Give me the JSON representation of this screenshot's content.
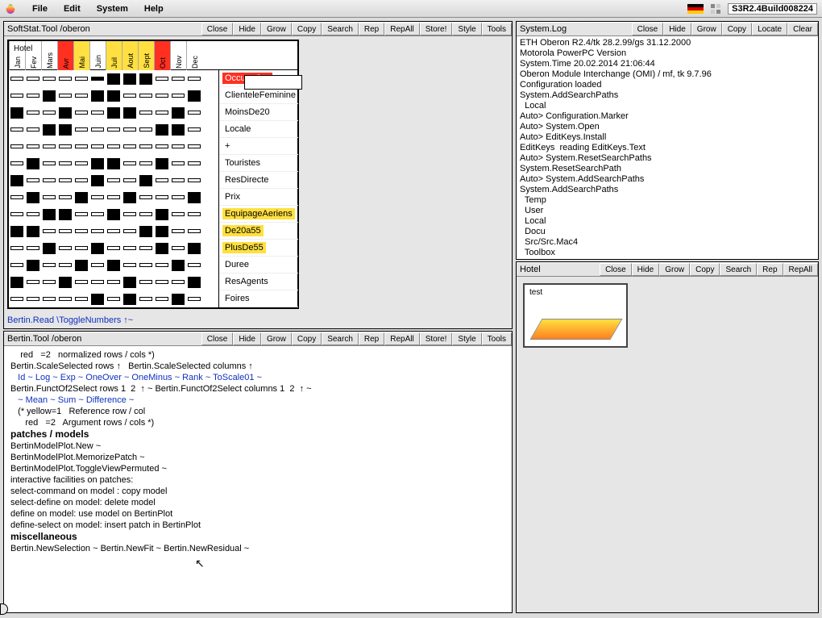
{
  "menubar": {
    "items": [
      "File",
      "Edit",
      "System",
      "Help"
    ],
    "build": "S3R2.4Build008224"
  },
  "soft_viewer": {
    "title": "SoftStat.Tool /oberon",
    "buttons": [
      "Close",
      "Hide",
      "Grow",
      "Copy",
      "Search",
      "Rep",
      "RepAll",
      "Store!"
    ],
    "right_buttons": [
      "Style",
      "Tools"
    ],
    "caption": "Hotel",
    "months": [
      {
        "label": "Jan",
        "color": ""
      },
      {
        "label": "Fev",
        "color": ""
      },
      {
        "label": "Mars",
        "color": ""
      },
      {
        "label": "Avr",
        "color": "red"
      },
      {
        "label": "Mai",
        "color": "yellow"
      },
      {
        "label": "Juin",
        "color": ""
      },
      {
        "label": "Juil",
        "color": "yellow"
      },
      {
        "label": "Aout",
        "color": "yellow"
      },
      {
        "label": "Sept",
        "color": "yellow"
      },
      {
        "label": "Oct",
        "color": "red"
      },
      {
        "label": "Nov",
        "color": ""
      },
      {
        "label": "Dec",
        "color": ""
      }
    ],
    "rows": [
      {
        "label": "Occupation",
        "color": "red",
        "pattern": [
          4,
          3,
          4,
          3,
          4,
          5,
          14,
          14,
          14,
          3,
          4,
          3
        ]
      },
      {
        "label": "ClienteleFeminine",
        "color": "",
        "pattern": [
          4,
          3,
          14,
          3,
          4,
          14,
          14,
          3,
          4,
          3,
          4,
          14
        ]
      },
      {
        "label": "MoinsDe20",
        "color": "",
        "pattern": [
          14,
          3,
          4,
          14,
          4,
          3,
          14,
          14,
          4,
          3,
          14,
          3
        ]
      },
      {
        "label": "Locale",
        "color": "",
        "pattern": [
          3,
          3,
          14,
          14,
          4,
          3,
          4,
          3,
          4,
          14,
          14,
          3
        ]
      },
      {
        "label": "+",
        "color": "",
        "pattern": [
          2,
          2,
          2,
          2,
          2,
          2,
          2,
          2,
          2,
          2,
          2,
          2
        ]
      },
      {
        "label": "Touristes",
        "color": "",
        "pattern": [
          4,
          14,
          3,
          4,
          3,
          14,
          14,
          3,
          4,
          14,
          4,
          3
        ]
      },
      {
        "label": "ResDirecte",
        "color": "",
        "pattern": [
          14,
          3,
          4,
          3,
          4,
          14,
          4,
          3,
          14,
          3,
          4,
          3
        ]
      },
      {
        "label": "Prix",
        "color": "",
        "pattern": [
          3,
          14,
          4,
          3,
          14,
          4,
          3,
          14,
          3,
          4,
          3,
          14
        ]
      },
      {
        "label": "EquipageAeriens",
        "color": "yellow",
        "pattern": [
          3,
          4,
          14,
          14,
          3,
          4,
          14,
          3,
          4,
          14,
          3,
          4
        ]
      },
      {
        "label": "De20a55",
        "color": "yellow",
        "pattern": [
          14,
          14,
          4,
          3,
          4,
          3,
          4,
          3,
          14,
          14,
          4,
          3
        ]
      },
      {
        "label": "PlusDe55",
        "color": "yellow",
        "pattern": [
          4,
          3,
          14,
          3,
          4,
          14,
          3,
          4,
          3,
          14,
          4,
          14
        ]
      },
      {
        "label": "Duree",
        "color": "",
        "pattern": [
          3,
          14,
          4,
          3,
          14,
          4,
          14,
          3,
          4,
          3,
          14,
          3
        ]
      },
      {
        "label": "ResAgents",
        "color": "",
        "pattern": [
          14,
          3,
          4,
          14,
          3,
          4,
          3,
          14,
          4,
          3,
          4,
          14
        ]
      },
      {
        "label": "Foires",
        "color": "",
        "pattern": [
          3,
          4,
          3,
          4,
          3,
          14,
          4,
          14,
          3,
          4,
          14,
          3
        ]
      }
    ],
    "cmd_line": "Bertin.Read   \\ToggleNumbers  ↑~"
  },
  "bertin_tool": {
    "title": "Bertin.Tool /oberon",
    "buttons": [
      "Close",
      "Hide",
      "Grow",
      "Copy",
      "Search",
      "Rep",
      "RepAll",
      "Store!"
    ],
    "right_buttons": [
      "Style",
      "Tools"
    ],
    "body_lines": [
      {
        "t": "    red   =2   normalized rows / cols *)",
        "c": ""
      },
      {
        "t": "",
        "c": ""
      },
      {
        "t": "Bertin.ScaleSelected rows ↑   Bertin.ScaleSelected columns ↑",
        "c": ""
      },
      {
        "t": "   Id ~ Log ~ Exp ~ OneOver ~ OneMinus ~ Rank ~ ToScale01 ~",
        "c": "blue"
      },
      {
        "t": "",
        "c": ""
      },
      {
        "t": "Bertin.FunctOf2Select rows 1  2  ↑ ~ Bertin.FunctOf2Select columns 1  2  ↑ ~",
        "c": ""
      },
      {
        "t": "   ~ Mean ~ Sum ~ Difference ~",
        "c": "blue"
      },
      {
        "t": "   (* yellow=1   Reference row / col",
        "c": ""
      },
      {
        "t": "      red   =2   Argument rows / cols *)",
        "c": ""
      },
      {
        "t": "",
        "c": ""
      },
      {
        "t": "patches / models",
        "c": "h"
      },
      {
        "t": "BertinModelPlot.New ~",
        "c": ""
      },
      {
        "t": "BertinModelPlot.MemorizePatch ~",
        "c": ""
      },
      {
        "t": "BertinModelPlot.ToggleViewPermuted ~",
        "c": ""
      },
      {
        "t": "",
        "c": ""
      },
      {
        "t": "interactive facilities on patches:",
        "c": ""
      },
      {
        "t": "",
        "c": ""
      },
      {
        "t": "select-command on model : copy model",
        "c": ""
      },
      {
        "t": "select-define on model: delete model",
        "c": ""
      },
      {
        "t": "define on model: use model on BertinPlot",
        "c": ""
      },
      {
        "t": "define-select on model: insert patch in BertinPlot",
        "c": ""
      },
      {
        "t": "",
        "c": ""
      },
      {
        "t": "miscellaneous",
        "c": "h"
      },
      {
        "t": "Bertin.NewSelection ~ Bertin.NewFit ~ Bertin.NewResidual ~",
        "c": ""
      }
    ]
  },
  "log_viewer": {
    "title": "System.Log",
    "buttons": [
      "Close",
      "Hide",
      "Grow",
      "Copy",
      "Locate",
      "Clear"
    ],
    "lines": [
      "ETH Oberon R2.4/tk 28.2.99/gs 31.12.2000",
      "Motorola PowerPC Version",
      "System.Time 20.02.2014 21:06:44",
      "Oberon Module Interchange (OMI) / mf, tk 9.7.96",
      "Configuration loaded",
      "System.AddSearchPaths",
      "  Local",
      "Auto> Configuration.Marker",
      "Auto> System.Open",
      "Auto> EditKeys.Install",
      "EditKeys  reading EditKeys.Text",
      "Auto> System.ResetSearchPaths",
      "System.ResetSearchPath",
      "Auto> System.AddSearchPaths",
      "System.AddSearchPaths",
      "  Temp",
      "  User",
      "  Local",
      "  Docu",
      "  Src/Src.Mac4",
      "  Toolbox"
    ]
  },
  "hotel_viewer": {
    "title": "Hotel",
    "buttons": [
      "Close",
      "Hide",
      "Grow",
      "Copy",
      "Search",
      "Rep",
      "RepAll"
    ],
    "preview_label": "test"
  }
}
